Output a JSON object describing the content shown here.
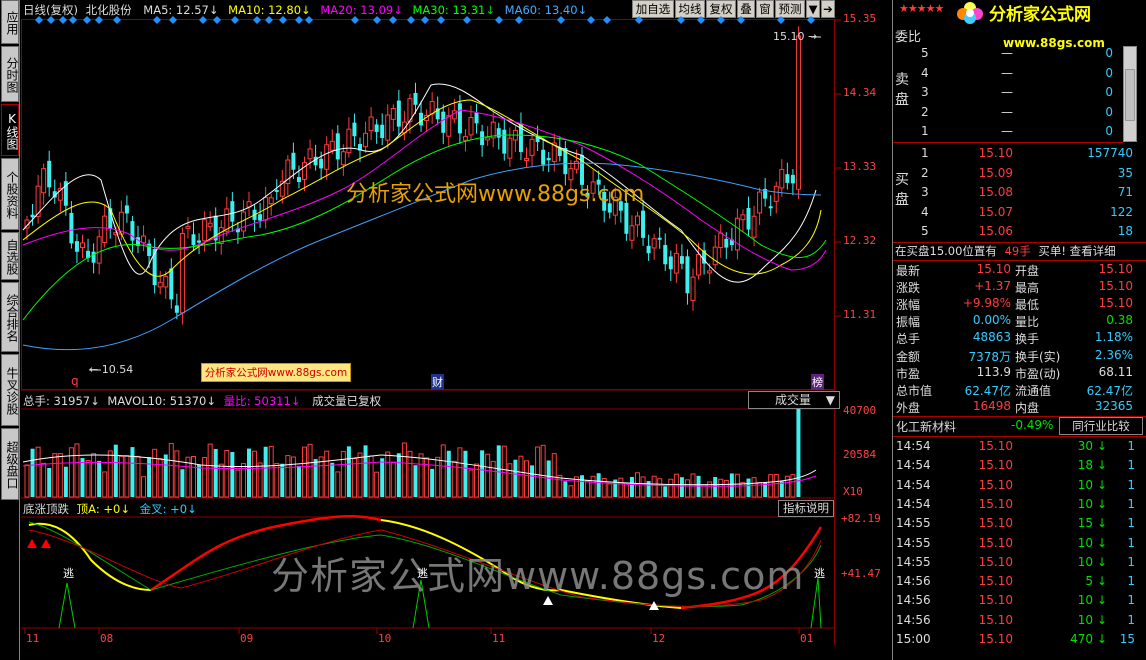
{
  "left_tabs": [
    "应用",
    "分时图",
    "K线图",
    "个股资料",
    "自选股",
    "综合排名",
    "牛叉诊股",
    "超级盘口"
  ],
  "header": {
    "chart_label": "日线(复权)",
    "stock_name": "北化股份",
    "ma5": "MA5: 12.57",
    "ma10": "MA10: 12.80",
    "ma20": "MA20: 13.09",
    "ma30": "MA30: 13.31",
    "ma60": "MA60: 13.40"
  },
  "top_buttons": [
    "加自选",
    "均线",
    "复权",
    "叠",
    "窗",
    "预测"
  ],
  "price_axis": [
    "15.35",
    "14.34",
    "13.33",
    "12.32",
    "11.31"
  ],
  "annotations": {
    "high_label": "15.10",
    "low_label": "10.54",
    "marker_q": "q",
    "marker_cai": "财",
    "marker_bang": "榜",
    "watermark_small": "分析家公式网www.88gs.com",
    "watermark_big": "分析家公式网www.88gs.com",
    "watermark_bottom": "分析家公式网www.88gs.com"
  },
  "volume": {
    "total": "总手: 31957",
    "mavol10": "MAVOL10: 51370",
    "ratio": "量比: 50311",
    "note": "成交量已复权",
    "dropdown": "成交量",
    "axis": [
      "40700",
      "20584",
      "X10"
    ]
  },
  "indicator": {
    "name": "底涨顶跌",
    "top_a": "顶A: +0",
    "gold": "金叉: +0",
    "button": "指标说明",
    "axis": [
      "+82.19",
      "+41.47"
    ],
    "escape_label": "逃"
  },
  "date_axis": [
    "11",
    "08",
    "09",
    "10",
    "11",
    "12",
    "01"
  ],
  "logo": {
    "text": "分析家公式网",
    "url": "www.88gs.com"
  },
  "order_book": {
    "title": "委比",
    "sell_label": "卖盘",
    "buy_label": "买盘",
    "sells": [
      {
        "level": "5",
        "price": "—",
        "vol": "0"
      },
      {
        "level": "4",
        "price": "—",
        "vol": "0"
      },
      {
        "level": "3",
        "price": "—",
        "vol": "0"
      },
      {
        "level": "2",
        "price": "—",
        "vol": "0"
      },
      {
        "level": "1",
        "price": "—",
        "vol": "0"
      }
    ],
    "buys": [
      {
        "level": "1",
        "price": "15.10",
        "vol": "157740"
      },
      {
        "level": "2",
        "price": "15.09",
        "vol": "35"
      },
      {
        "level": "3",
        "price": "15.08",
        "vol": "71"
      },
      {
        "level": "4",
        "price": "15.07",
        "vol": "122"
      },
      {
        "level": "5",
        "price": "15.06",
        "vol": "18"
      }
    ],
    "notice": "在买盘15.00位置有",
    "notice_vol": "49手",
    "notice_tail": "买单! 查看详细"
  },
  "quote": [
    {
      "l1": "最新",
      "v1": "15.10",
      "l2": "开盘",
      "v2": "15.10",
      "c1": "r",
      "c2": "r"
    },
    {
      "l1": "涨跌",
      "v1": "+1.37",
      "l2": "最高",
      "v2": "15.10",
      "c1": "r",
      "c2": "r"
    },
    {
      "l1": "涨幅",
      "v1": "+9.98%",
      "l2": "最低",
      "v2": "15.10",
      "c1": "r",
      "c2": "r"
    },
    {
      "l1": "振幅",
      "v1": "0.00%",
      "l2": "量比",
      "v2": "0.38",
      "c1": "c",
      "c2": "g"
    },
    {
      "l1": "总手",
      "v1": "48863",
      "l2": "换手",
      "v2": "1.18%",
      "c1": "c",
      "c2": "c"
    },
    {
      "l1": "金额",
      "v1": "7378万",
      "l2": "换手(实)",
      "v2": "2.36%",
      "c1": "c",
      "c2": "c"
    },
    {
      "l1": "市盈",
      "v1": "113.9",
      "l2": "市盈(动)",
      "v2": "68.11",
      "c1": "w",
      "c2": "w"
    },
    {
      "l1": "总市值",
      "v1": "62.47亿",
      "l2": "流通值",
      "v2": "62.47亿",
      "c1": "c",
      "c2": "c"
    },
    {
      "l1": "外盘",
      "v1": "16498",
      "l2": "内盘",
      "v2": "32365",
      "c1": "r",
      "c2": "c"
    }
  ],
  "sector": {
    "name": "化工新材料",
    "change": "-0.49%",
    "button": "同行业比较"
  },
  "ticks": [
    {
      "time": "14:54",
      "price": "15.10",
      "vol": "30",
      "n": "1"
    },
    {
      "time": "14:54",
      "price": "15.10",
      "vol": "18",
      "n": "1"
    },
    {
      "time": "14:54",
      "price": "15.10",
      "vol": "10",
      "n": "1"
    },
    {
      "time": "14:54",
      "price": "15.10",
      "vol": "10",
      "n": "1"
    },
    {
      "time": "14:55",
      "price": "15.10",
      "vol": "15",
      "n": "1"
    },
    {
      "time": "14:55",
      "price": "15.10",
      "vol": "10",
      "n": "1"
    },
    {
      "time": "14:55",
      "price": "15.10",
      "vol": "10",
      "n": "1"
    },
    {
      "time": "14:56",
      "price": "15.10",
      "vol": "5",
      "n": "1"
    },
    {
      "time": "14:56",
      "price": "15.10",
      "vol": "10",
      "n": "1"
    },
    {
      "time": "14:56",
      "price": "15.10",
      "vol": "10",
      "n": "1"
    },
    {
      "time": "15:00",
      "price": "15.10",
      "vol": "470",
      "n": "15"
    }
  ],
  "colors": {
    "up": "#ff3c3c",
    "down": "#3cf0f0",
    "ma5": "#ffffff",
    "ma10": "#ffff00",
    "ma20": "#ff00ff",
    "ma30": "#00ff00",
    "ma60": "#40a0ff"
  }
}
